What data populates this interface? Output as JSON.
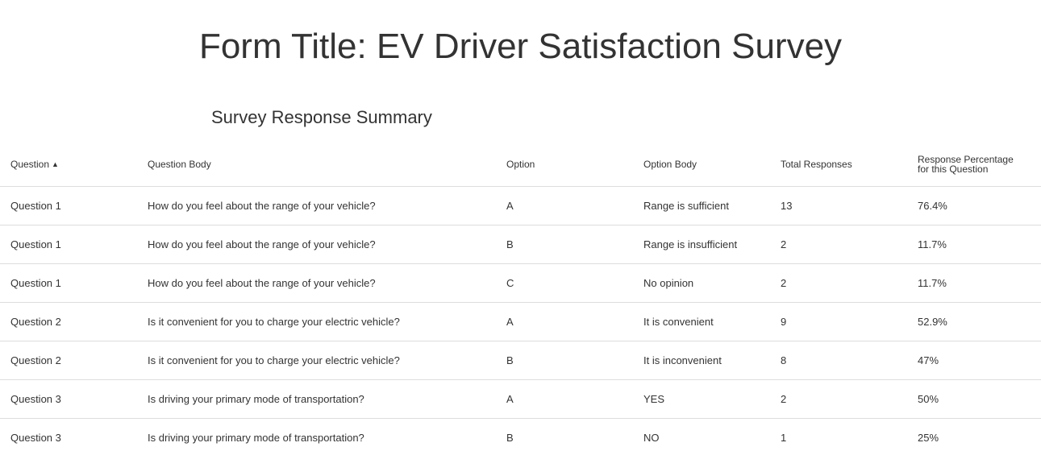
{
  "form_title": "Form Title: EV Driver Satisfaction Survey",
  "summary_title": "Survey Response Summary",
  "table": {
    "headers": {
      "question": "Question",
      "sort_indicator": "▲",
      "question_body": "Question Body",
      "option": "Option",
      "option_body": "Option Body",
      "total_responses": "Total Responses",
      "response_percentage": "Response Percentage for this Question"
    },
    "rows": [
      {
        "question": "Question 1",
        "question_body": "How do you feel about the range of your vehicle?",
        "option": "A",
        "option_body": "Range is sufficient",
        "total": "13",
        "percentage": "76.4%"
      },
      {
        "question": "Question 1",
        "question_body": "How do you feel about the range of your vehicle?",
        "option": "B",
        "option_body": "Range is insufficient",
        "total": "2",
        "percentage": "11.7%"
      },
      {
        "question": "Question 1",
        "question_body": "How do you feel about the range of your vehicle?",
        "option": "C",
        "option_body": "No opinion",
        "total": "2",
        "percentage": "11.7%"
      },
      {
        "question": "Question 2",
        "question_body": "Is it convenient for you to charge your electric vehicle?",
        "option": "A",
        "option_body": "It is convenient",
        "total": "9",
        "percentage": "52.9%"
      },
      {
        "question": "Question 2",
        "question_body": "Is it convenient for you to charge your electric vehicle?",
        "option": "B",
        "option_body": "It is inconvenient",
        "total": "8",
        "percentage": "47%"
      },
      {
        "question": "Question 3",
        "question_body": "Is driving your primary mode of transportation?",
        "option": "A",
        "option_body": "YES",
        "total": "2",
        "percentage": "50%"
      },
      {
        "question": "Question 3",
        "question_body": "Is driving your primary mode of transportation?",
        "option": "B",
        "option_body": "NO",
        "total": "1",
        "percentage": "25%"
      }
    ]
  }
}
